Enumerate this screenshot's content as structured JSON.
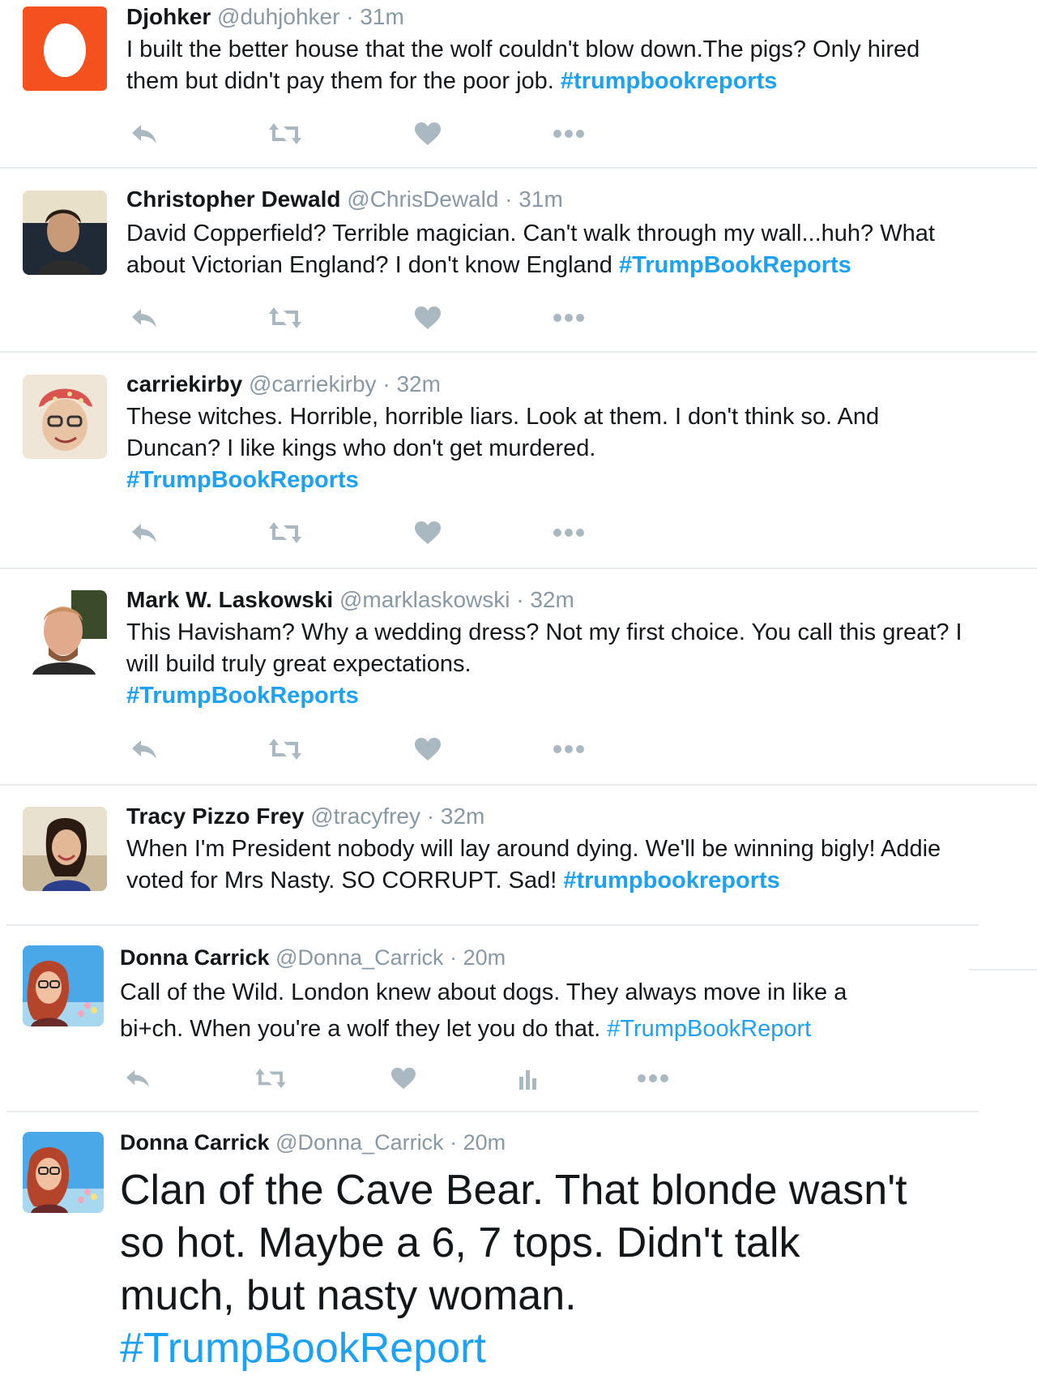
{
  "colors": {
    "accent": "#1da1f2",
    "muted": "#8899a6",
    "icon": "#aab8c2",
    "egg": "#f4511e"
  },
  "tweets": [
    {
      "name": "Djohker",
      "handle": "@duhjohker",
      "time": "31m",
      "dot": "·",
      "text": "I built the better house that the wolf couldn't blow down.The pigs? Only hired\nthem but didn't pay them for the poor job. ",
      "hashtag": "#trumpbookreports",
      "avatar_icon": "egg-icon"
    },
    {
      "name": "Christopher Dewald",
      "handle": "@ChrisDewald",
      "time": "31m",
      "dot": "·",
      "text": "David Copperfield? Terrible magician. Can't walk through my wall...huh? What\nabout Victorian England? I don't know England ",
      "hashtag": "#TrumpBookReports",
      "avatar_icon": "profile-photo"
    },
    {
      "name": "carriekirby",
      "handle": "@carriekirby",
      "time": "32m",
      "dot": "·",
      "text": "These witches. Horrible, horrible liars. Look at them. I don't think so. And\nDuncan? I like kings who don't get murdered.\n",
      "hashtag": "#TrumpBookReports",
      "avatar_icon": "profile-photo"
    },
    {
      "name": "Mark W. Laskowski",
      "handle": "@marklaskowski",
      "time": "32m",
      "dot": "·",
      "text": "This Havisham? Why a wedding dress? Not my first choice. You call this great? I\nwill build truly great expectations.\n",
      "hashtag": "#TrumpBookReports",
      "avatar_icon": "profile-photo"
    },
    {
      "name": "Tracy Pizzo Frey",
      "handle": "@tracyfrey",
      "time": "32m",
      "dot": "·",
      "text": "When I'm President nobody will lay around dying. We'll be winning bigly! Addie\nvoted for Mrs Nasty. SO CORRUPT. Sad! ",
      "hashtag": "#trumpbookreports",
      "avatar_icon": "profile-photo"
    },
    {
      "name": "Donna Carrick",
      "handle": "@Donna_Carrick",
      "time": "20m",
      "dot": "·",
      "text": "Call of the Wild. London knew about dogs. They always move in like a\nbi+ch. When you're a wolf they let you do that. ",
      "hashtag": "#TrumpBookReport",
      "avatar_icon": "profile-photo"
    },
    {
      "name": "Donna Carrick",
      "handle": "@Donna_Carrick",
      "time": "20m",
      "dot": "·",
      "text": "Clan of the Cave Bear. That blonde wasn't\nso hot. Maybe a 6, 7 tops. Didn't talk\nmuch, but nasty woman.\n",
      "hashtag": "#TrumpBookReport",
      "avatar_icon": "profile-photo"
    }
  ],
  "actions": [
    "reply-icon",
    "retweet-icon",
    "like-icon",
    "analytics-icon",
    "more-icon"
  ]
}
